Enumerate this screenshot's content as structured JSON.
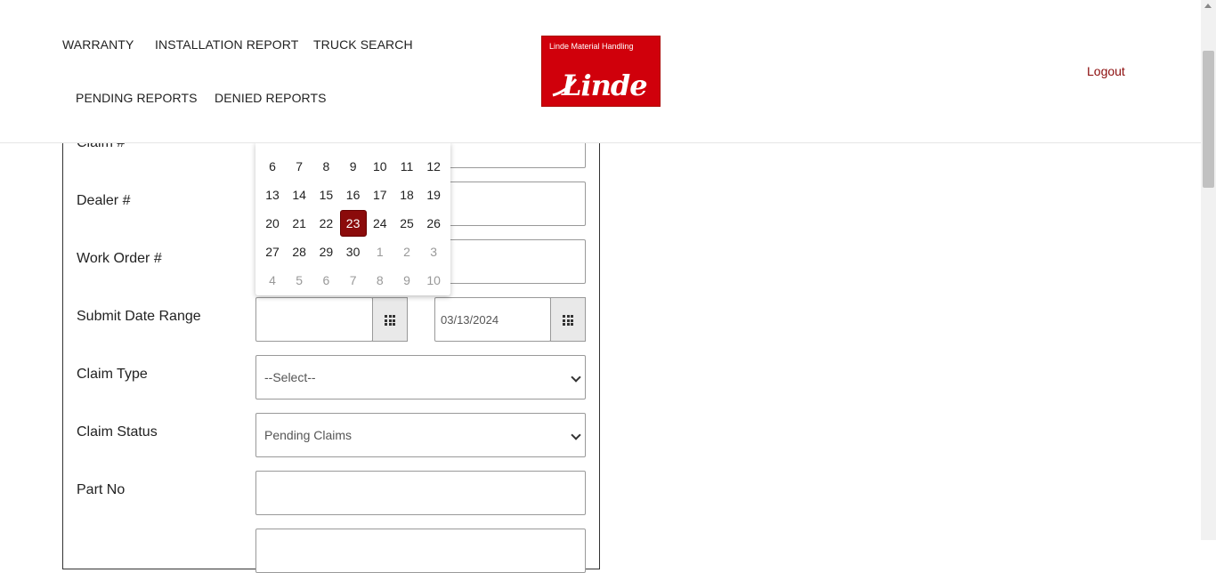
{
  "nav": {
    "warranty": "WARRANTY",
    "installation_report": "INSTALLATION REPORT",
    "truck_search": "TRUCK SEARCH",
    "pending_reports": "PENDING REPORTS",
    "denied_reports": "DENIED REPORTS"
  },
  "logo": {
    "top_text": "Linde Material Handling",
    "word": "Linde",
    "color": "#d0000b"
  },
  "logout": "Logout",
  "form": {
    "claim_label": "Claim #",
    "dealer_label": "Dealer #",
    "work_order_label": "Work Order #",
    "submit_date_range_label": "Submit Date Range",
    "date_from_value": "",
    "date_to_value": "03/13/2024",
    "claim_type_label": "Claim Type",
    "claim_type_selected": "--Select--",
    "claim_status_label": "Claim Status",
    "claim_status_selected": "Pending Claims",
    "part_no_label": "Part No"
  },
  "calendar": {
    "rows": [
      [
        {
          "d": "6"
        },
        {
          "d": "7"
        },
        {
          "d": "8"
        },
        {
          "d": "9"
        },
        {
          "d": "10"
        },
        {
          "d": "11"
        },
        {
          "d": "12"
        }
      ],
      [
        {
          "d": "13"
        },
        {
          "d": "14"
        },
        {
          "d": "15"
        },
        {
          "d": "16"
        },
        {
          "d": "17"
        },
        {
          "d": "18"
        },
        {
          "d": "19"
        }
      ],
      [
        {
          "d": "20"
        },
        {
          "d": "21"
        },
        {
          "d": "22"
        },
        {
          "d": "23",
          "selected": true
        },
        {
          "d": "24"
        },
        {
          "d": "25"
        },
        {
          "d": "26"
        }
      ],
      [
        {
          "d": "27"
        },
        {
          "d": "28"
        },
        {
          "d": "29"
        },
        {
          "d": "30"
        },
        {
          "d": "1",
          "muted": true
        },
        {
          "d": "2",
          "muted": true
        },
        {
          "d": "3",
          "muted": true
        }
      ],
      [
        {
          "d": "4",
          "muted": true
        },
        {
          "d": "5",
          "muted": true
        },
        {
          "d": "6",
          "muted": true
        },
        {
          "d": "7",
          "muted": true
        },
        {
          "d": "8",
          "muted": true
        },
        {
          "d": "9",
          "muted": true
        },
        {
          "d": "10",
          "muted": true
        }
      ]
    ],
    "selected_color": "#8b0b0b"
  },
  "icons": {
    "calendar_button": "grid-icon",
    "select_arrow": "chevron-down-icon"
  }
}
